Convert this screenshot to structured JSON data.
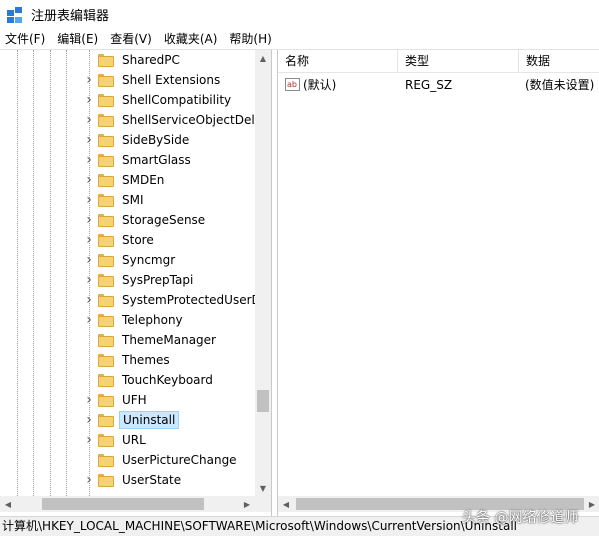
{
  "window": {
    "title": "注册表编辑器"
  },
  "menu": [
    "文件(F)",
    "编辑(E)",
    "查看(V)",
    "收藏夹(A)",
    "帮助(H)"
  ],
  "tree": {
    "nodes": [
      {
        "label": "SharedPC",
        "expandable": false
      },
      {
        "label": "Shell Extensions",
        "expandable": true
      },
      {
        "label": "ShellCompatibility",
        "expandable": true
      },
      {
        "label": "ShellServiceObjectDela",
        "expandable": true
      },
      {
        "label": "SideBySide",
        "expandable": true
      },
      {
        "label": "SmartGlass",
        "expandable": true
      },
      {
        "label": "SMDEn",
        "expandable": true
      },
      {
        "label": "SMI",
        "expandable": true
      },
      {
        "label": "StorageSense",
        "expandable": true
      },
      {
        "label": "Store",
        "expandable": true
      },
      {
        "label": "Syncmgr",
        "expandable": true
      },
      {
        "label": "SysPrepTapi",
        "expandable": true
      },
      {
        "label": "SystemProtectedUserD",
        "expandable": true
      },
      {
        "label": "Telephony",
        "expandable": true
      },
      {
        "label": "ThemeManager",
        "expandable": false
      },
      {
        "label": "Themes",
        "expandable": false
      },
      {
        "label": "TouchKeyboard",
        "expandable": false
      },
      {
        "label": "UFH",
        "expandable": true
      },
      {
        "label": "Uninstall",
        "expandable": true,
        "selected": true
      },
      {
        "label": "URL",
        "expandable": true
      },
      {
        "label": "UserPictureChange",
        "expandable": false
      },
      {
        "label": "UserState",
        "expandable": true
      }
    ]
  },
  "list": {
    "columns": [
      "名称",
      "类型",
      "数据"
    ],
    "rows": [
      {
        "name": "(默认)",
        "type": "REG_SZ",
        "data": "(数值未设置)",
        "icon": "ab"
      }
    ]
  },
  "status": {
    "path": "计算机\\HKEY_LOCAL_MACHINE\\SOFTWARE\\Microsoft\\Windows\\CurrentVersion\\Uninstall"
  },
  "watermark": "头条 @网络修道师",
  "colors": {
    "selection": "#cce8ff",
    "folder": "#f5d272",
    "accent": "#2b7bd6"
  }
}
